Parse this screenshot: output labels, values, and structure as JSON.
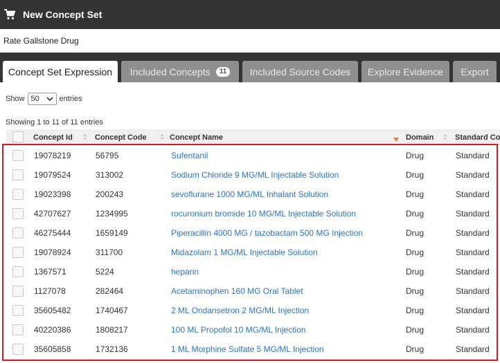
{
  "header": {
    "title": "New Concept Set",
    "icon": "shopping-cart-icon"
  },
  "concept_set_name": "Rate Gallstone Drug",
  "tabs": [
    {
      "label": "Concept Set Expression",
      "active": true
    },
    {
      "label": "Included Concepts",
      "badge": "11"
    },
    {
      "label": "Included Source Codes"
    },
    {
      "label": "Explore Evidence"
    },
    {
      "label": "Export"
    }
  ],
  "table_controls": {
    "show_label": "Show",
    "page_size": "50",
    "entries_label": "entries",
    "info": "Showing 1 to 11 of 11 entries"
  },
  "columns": [
    "Concept Id",
    "Concept Code",
    "Concept Name",
    "Domain",
    "Standard Co"
  ],
  "rows": [
    {
      "id": "19078219",
      "code": "56795",
      "name": "Sufentanil",
      "domain": "Drug",
      "standard": "Standard"
    },
    {
      "id": "19079524",
      "code": "313002",
      "name": "Sodium Chloride 9 MG/ML Injectable Solution",
      "domain": "Drug",
      "standard": "Standard"
    },
    {
      "id": "19023398",
      "code": "200243",
      "name": "sevoflurane 1000 MG/ML Inhalant Solution",
      "domain": "Drug",
      "standard": "Standard"
    },
    {
      "id": "42707627",
      "code": "1234995",
      "name": "rocuronium bromide 10 MG/ML Injectable Solution",
      "domain": "Drug",
      "standard": "Standard"
    },
    {
      "id": "46275444",
      "code": "1659149",
      "name": "Piperacillin 4000 MG / tazobactam 500 MG Injection",
      "domain": "Drug",
      "standard": "Standard"
    },
    {
      "id": "19078924",
      "code": "311700",
      "name": "Midazolam 1 MG/ML Injectable Solution",
      "domain": "Drug",
      "standard": "Standard"
    },
    {
      "id": "1367571",
      "code": "5224",
      "name": "heparin",
      "domain": "Drug",
      "standard": "Standard"
    },
    {
      "id": "1127078",
      "code": "282464",
      "name": "Acetaminophen 160 MG Oral Tablet",
      "domain": "Drug",
      "standard": "Standard"
    },
    {
      "id": "35605482",
      "code": "1740467",
      "name": "2 ML Ondansetron 2 MG/ML Injection",
      "domain": "Drug",
      "standard": "Standard"
    },
    {
      "id": "40220386",
      "code": "1808217",
      "name": "100 ML Propofol 10 MG/ML Injection",
      "domain": "Drug",
      "standard": "Standard"
    },
    {
      "id": "35605858",
      "code": "1732136",
      "name": "1 ML Morphine Sulfate 5 MG/ML Injection",
      "domain": "Drug",
      "standard": "Standard"
    }
  ],
  "colors": {
    "topbar": "#333333",
    "link": "#2a73c7",
    "highlight": "#e0141e",
    "sort_active": "#e8802a"
  }
}
